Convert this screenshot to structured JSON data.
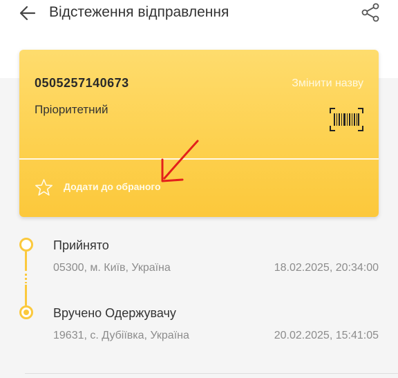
{
  "header": {
    "title": "Відстеження відправлення",
    "back_icon": "arrow-left-icon",
    "share_icon": "share-icon"
  },
  "card": {
    "tracking_number": "0505257140673",
    "rename_label": "Змінити назву",
    "service_type": "Пріоритетний",
    "barcode_icon": "barcode-icon",
    "favorite_label": "Додати до обраного",
    "favorite_icon": "star-outline-icon",
    "accent_color": "#fdd04d"
  },
  "annotation": {
    "arrow_color": "#e3201b"
  },
  "events": [
    {
      "status": "Прийнято",
      "place": "05300, м. Київ, Україна",
      "datetime": "18.02.2025, 20:34:00"
    },
    {
      "status": "Вручено Одержувачу",
      "place": "19631, с. Дубіївка, Україна",
      "datetime": "20.02.2025, 15:41:05"
    }
  ]
}
